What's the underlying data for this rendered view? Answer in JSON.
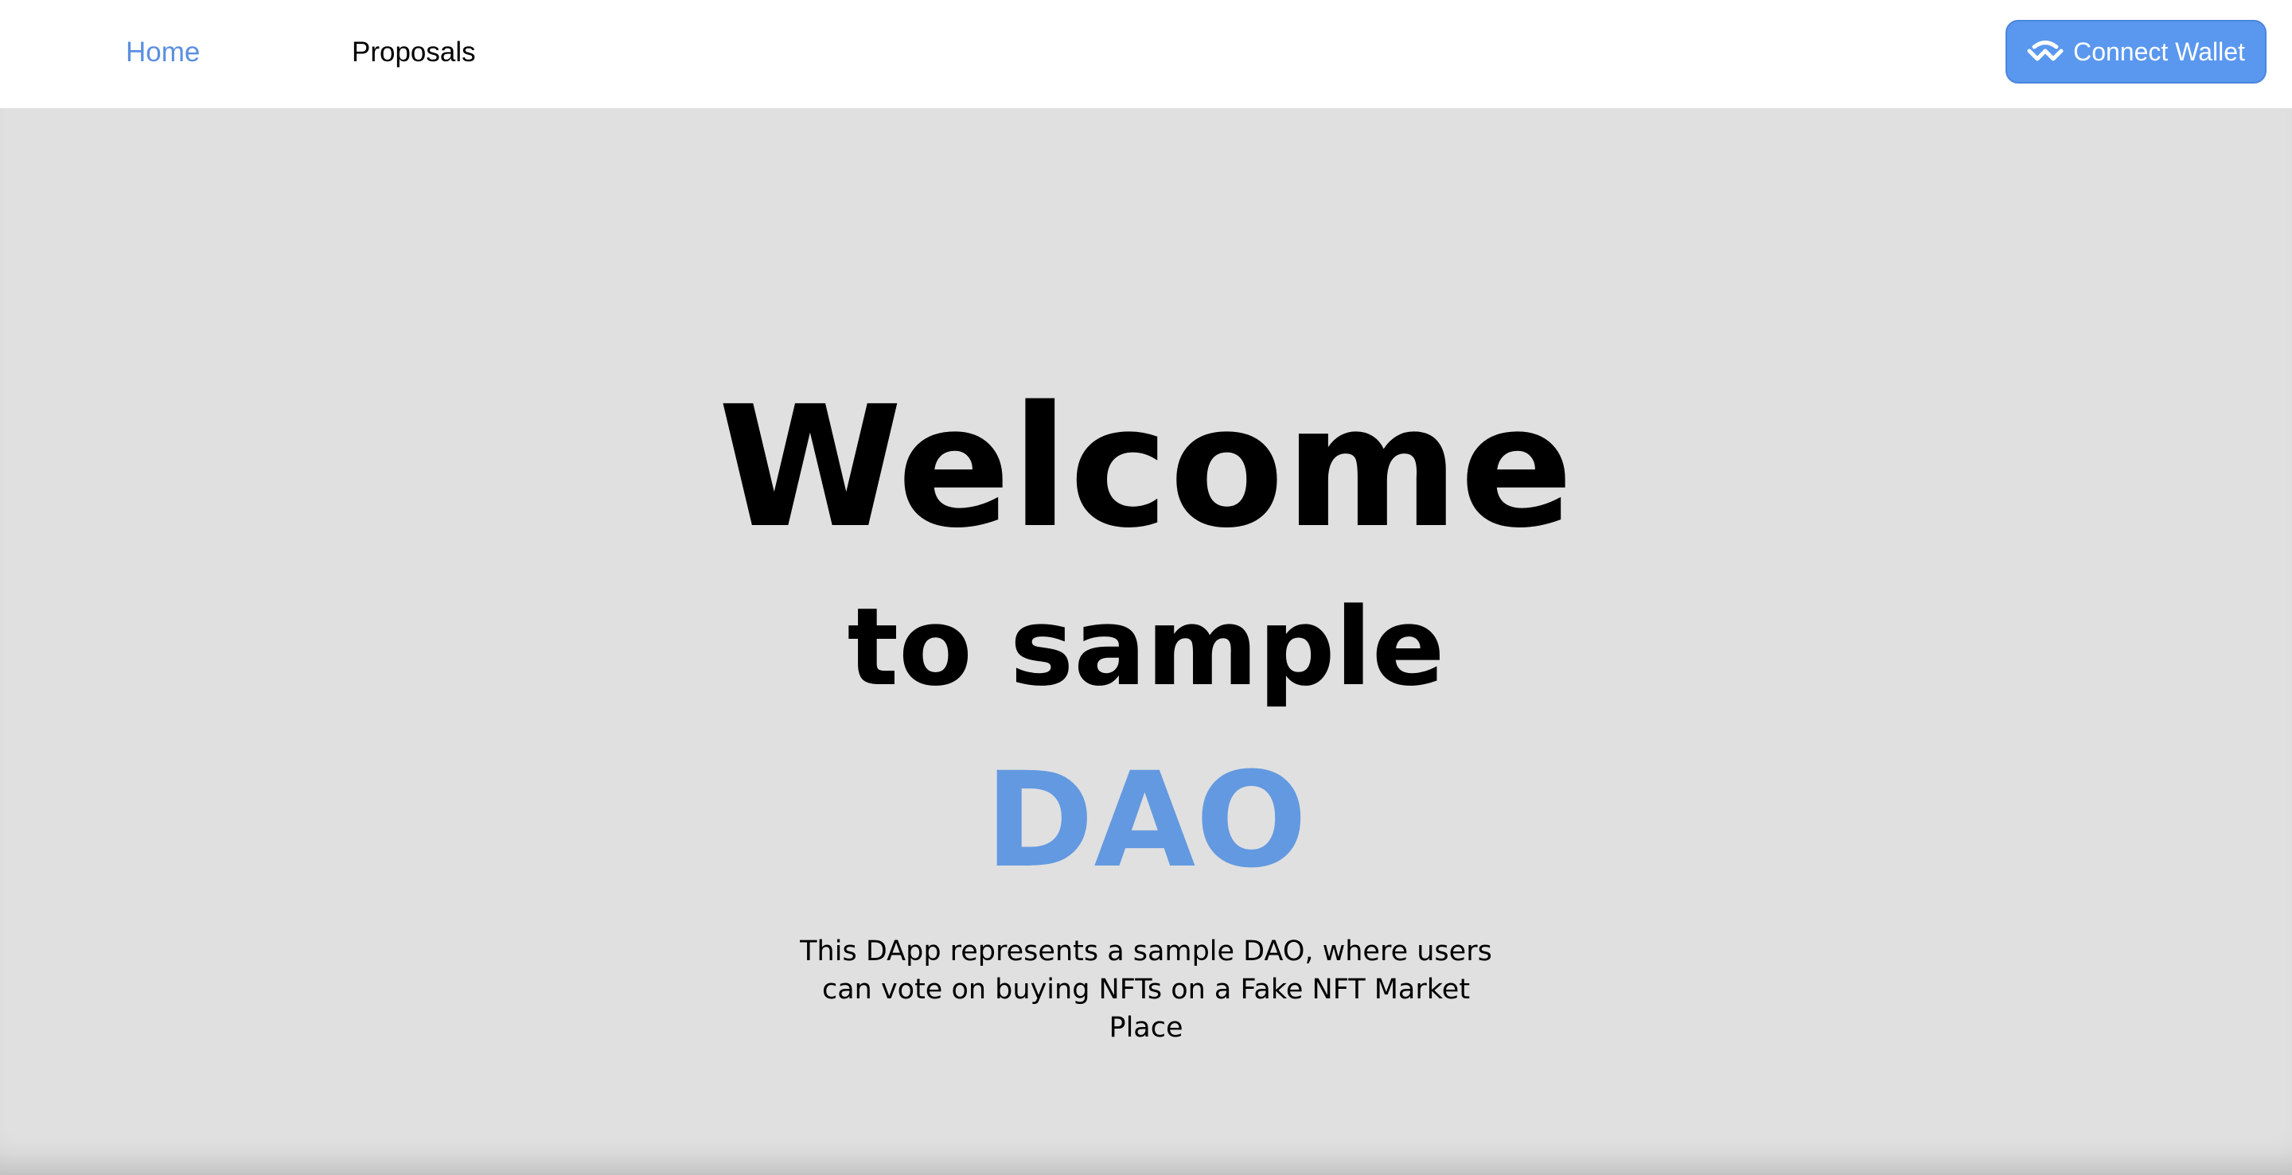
{
  "nav": {
    "links": [
      {
        "label": "Home",
        "active": true
      },
      {
        "label": "Proposals",
        "active": false
      }
    ],
    "connect_button": {
      "label": "Connect Wallet",
      "icon": "walletconnect-icon"
    }
  },
  "hero": {
    "title": "Welcome",
    "subtitle": "to sample",
    "accent": "DAO",
    "description": "This DApp represents a sample DAO, where users can vote on buying NFTs on a Fake NFT Market Place"
  },
  "colors": {
    "accent": "#6399e0",
    "button": "#5a98ef",
    "hero_background": "#e0e0e1",
    "nav_background": "#ffffff"
  }
}
